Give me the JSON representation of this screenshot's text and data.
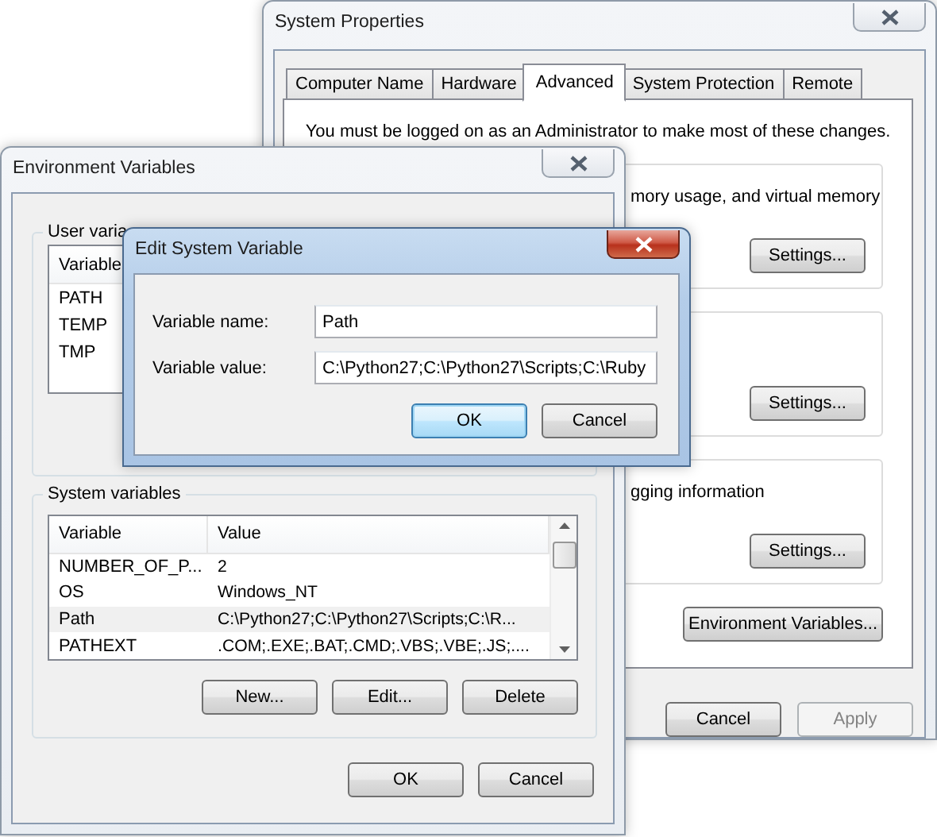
{
  "system_properties": {
    "title": "System Properties",
    "tabs": [
      {
        "label": "Computer Name",
        "selected": false
      },
      {
        "label": "Hardware",
        "selected": false
      },
      {
        "label": "Advanced",
        "selected": true
      },
      {
        "label": "System Protection",
        "selected": false
      },
      {
        "label": "Remote",
        "selected": false
      }
    ],
    "notice": "You must be logged on as an Administrator to make most of these changes.",
    "groups": [
      {
        "text": "mory usage, and virtual memory",
        "button": "Settings..."
      },
      {
        "button": "Settings..."
      },
      {
        "text": "gging information",
        "button": "Settings..."
      }
    ],
    "env_button": "Environment Variables...",
    "buttons": [
      {
        "label": "Cancel",
        "disabled": false
      },
      {
        "label": "Apply",
        "disabled": true
      }
    ]
  },
  "environment_variables": {
    "title": "Environment Variables",
    "user_group": {
      "label": "User varia",
      "columns": [
        "Variable"
      ],
      "rows": [
        "PATH",
        "TEMP",
        "TMP"
      ]
    },
    "system_group": {
      "label": "System variables",
      "columns": [
        "Variable",
        "Value"
      ],
      "rows": [
        {
          "variable": "NUMBER_OF_P...",
          "value": "2",
          "selected": false
        },
        {
          "variable": "OS",
          "value": "Windows_NT",
          "selected": false
        },
        {
          "variable": "Path",
          "value": "C:\\Python27;C:\\Python27\\Scripts;C:\\R...",
          "selected": true
        },
        {
          "variable": "PATHEXT",
          "value": ".COM;.EXE;.BAT;.CMD;.VBS;.VBE;.JS;....",
          "selected": false
        }
      ],
      "buttons": [
        "New...",
        "Edit...",
        "Delete"
      ]
    },
    "buttons": [
      "OK",
      "Cancel"
    ]
  },
  "edit_dialog": {
    "title": "Edit System Variable",
    "fields": [
      {
        "label": "Variable name:",
        "value": "Path"
      },
      {
        "label": "Variable value:",
        "value": "C:\\Python27;C:\\Python27\\Scripts;C:\\Ruby"
      }
    ],
    "buttons": [
      {
        "label": "OK",
        "default": true
      },
      {
        "label": "Cancel",
        "default": false
      }
    ]
  }
}
